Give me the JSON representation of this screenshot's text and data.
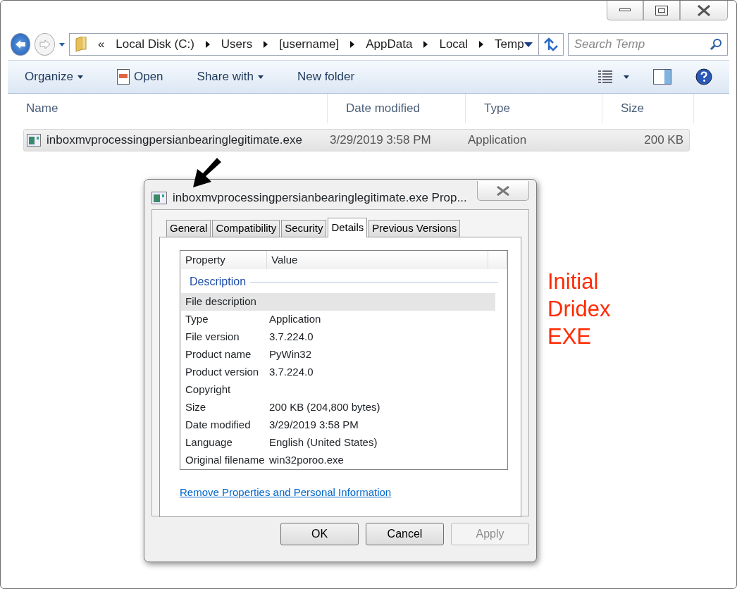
{
  "window": {
    "caption_buttons": [
      {
        "kind": "minimize"
      },
      {
        "kind": "maximize"
      },
      {
        "kind": "close"
      }
    ]
  },
  "address_bar": {
    "overflow": "«",
    "crumbs": [
      "Local Disk (C:)",
      "Users",
      "[username]",
      "AppData",
      "Local",
      "Temp"
    ]
  },
  "search": {
    "placeholder": "Search Temp"
  },
  "toolbar": [
    {
      "label": "Organize",
      "dropdown": true,
      "icon": false
    },
    {
      "label": "Open",
      "dropdown": false,
      "icon": true
    },
    {
      "label": "Share with",
      "dropdown": true,
      "icon": false
    },
    {
      "label": "New folder",
      "dropdown": false,
      "icon": false
    }
  ],
  "columns": [
    "Name",
    "Date modified",
    "Type",
    "Size"
  ],
  "files": [
    {
      "name": "inboxmvprocessingpersianbearinglegitimate.exe",
      "date": "3/29/2019 3:58 PM",
      "type": "Application",
      "size": "200 KB",
      "selected": true
    }
  ],
  "dialog": {
    "title": "inboxmvprocessingpersianbearinglegitimate.exe Prop...",
    "tabs": [
      {
        "label": "General",
        "selected": false
      },
      {
        "label": "Compatibility",
        "selected": false
      },
      {
        "label": "Security",
        "selected": false
      },
      {
        "label": "Details",
        "selected": true
      },
      {
        "label": "Previous Versions",
        "selected": false
      }
    ],
    "columns": [
      "Property",
      "Value"
    ],
    "section": "Description",
    "rows": [
      {
        "property": "File description",
        "selected": true
      },
      {
        "property": "Type",
        "value": "Application",
        "selected": false
      },
      {
        "property": "File version",
        "value": "3.7.224.0",
        "selected": false
      },
      {
        "property": "Product name",
        "value": "PyWin32",
        "selected": false
      },
      {
        "property": "Product version",
        "value": "3.7.224.0",
        "selected": false
      },
      {
        "property": "Copyright",
        "selected": false
      },
      {
        "property": "Size",
        "value": "200 KB (204,800 bytes)",
        "selected": false
      },
      {
        "property": "Date modified",
        "value": "3/29/2019 3:58 PM",
        "selected": false
      },
      {
        "property": "Language",
        "value": "English (United States)",
        "selected": false
      },
      {
        "property": "Original filename",
        "value": "win32poroo.exe",
        "selected": false
      }
    ],
    "link": "Remove Properties and Personal Information",
    "buttons": [
      {
        "label": "OK",
        "disabled": false
      },
      {
        "label": "Cancel",
        "disabled": false
      },
      {
        "label": "Apply",
        "disabled": true
      }
    ]
  },
  "annotation": {
    "lines": [
      "Initial",
      "Dridex",
      "EXE"
    ],
    "color": "#ff2a00"
  }
}
